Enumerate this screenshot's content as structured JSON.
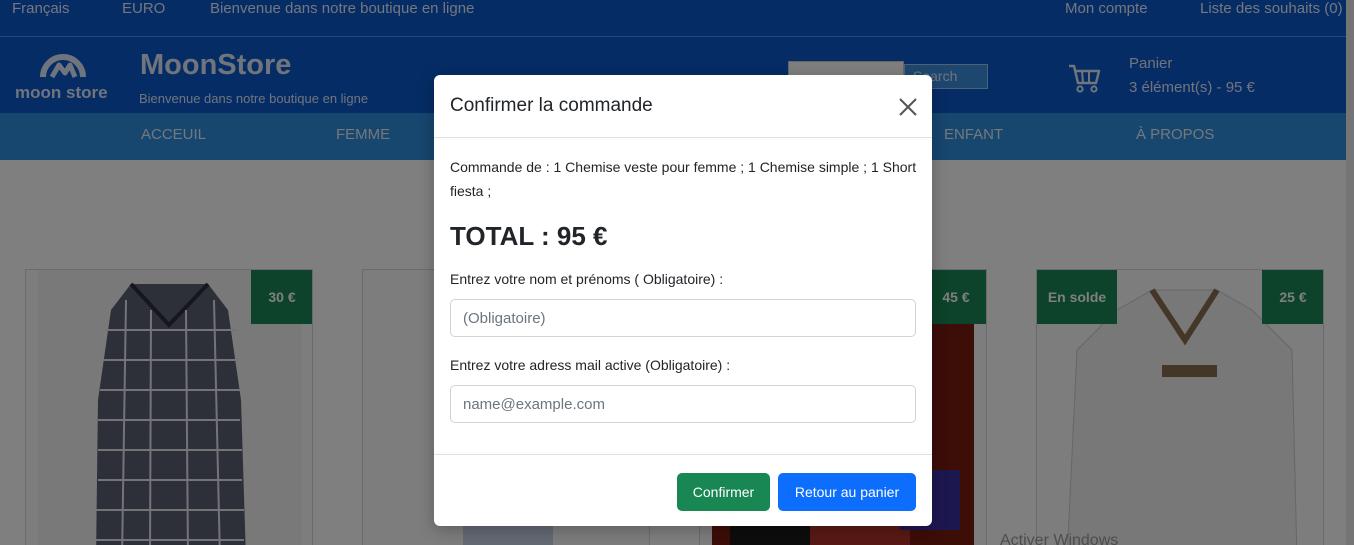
{
  "topbar": {
    "language": "Français",
    "currency": "EURO",
    "welcome": "Bienvenue dans notre boutique en ligne",
    "account": "Mon compte",
    "wishlist": "Liste des souhaits (0)"
  },
  "header": {
    "logo_text": "moon store",
    "brand": "MoonStore",
    "tagline": "Bienvenue dans notre boutique en ligne",
    "search_button": "Search",
    "cart_label": "Panier",
    "cart_summary": "3 élément(s) - 95 €"
  },
  "nav": {
    "items": [
      "ACCEUIL",
      "FEMME",
      "ENFANT",
      "À PROPOS"
    ]
  },
  "products": [
    {
      "price": "30 €"
    },
    {
      "price": ""
    },
    {
      "price": "45 €"
    },
    {
      "price": "25 €",
      "sale_badge": "En solde"
    }
  ],
  "modal": {
    "title": "Confirmer la commande",
    "order_text": "Commande de : 1 Chemise veste pour femme ; 1 Chemise simple ; 1 Short fiesta ;",
    "total": "TOTAL : 95 €",
    "name_label": "Entrez votre nom et prénoms ( Obligatoire) :",
    "name_placeholder": "(Obligatoire)",
    "mail_label": "Entrez votre adress mail active (Obligatoire) :",
    "mail_placeholder": "name@example.com",
    "confirm_button": "Confirmer",
    "back_button": "Retour au panier"
  },
  "colors": {
    "header_blue": "#0a58ca",
    "nav_blue": "#2e8ddf",
    "success_green": "#198754",
    "primary_blue": "#0d6efd"
  }
}
